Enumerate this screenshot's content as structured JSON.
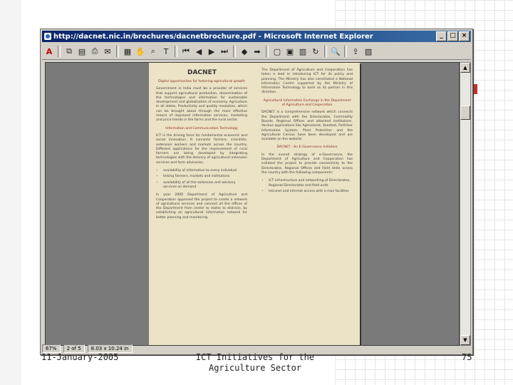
{
  "window": {
    "title": "http://dacnet.nic.in/brochures/dacnetbrochure.pdf - Microsoft Internet Explorer",
    "buttons": [
      "_",
      "□",
      "×"
    ]
  },
  "toolbar": {
    "icons": [
      "acrobat-icon",
      "separator",
      "copy-icon",
      "save-icon",
      "print-icon",
      "mail-icon",
      "separator",
      "pages-icon",
      "hand-tool-icon",
      "zoom-tool-icon",
      "text-select-icon",
      "separator",
      "first-page-icon",
      "prev-page-icon",
      "next-page-icon",
      "last-page-icon",
      "separator",
      "back-icon",
      "forward-icon",
      "separator",
      "actual-size-icon",
      "fit-page-icon",
      "fit-width-icon",
      "rotate-icon",
      "separator",
      "find-icon",
      "separator",
      "export-icon",
      "settings-icon"
    ]
  },
  "statusbar": {
    "zoom": "67%",
    "page": "2 of 5",
    "size": "8.03 x 10.24 in"
  },
  "pdf": {
    "title": "DACNET",
    "left_col": {
      "subtitle": "Digital opportunities for fostering agricultural growth",
      "p1": "Government in India must be a provider of services that support agricultural production, dissemination of the technologies and information for sustainable development and globalisation of economy. Agriculture in all states, Productivity and quality revolution, which can be brought about through the most effective means of improved information services, marketing and price trends in the farms and the rural sector.",
      "heading": "Information and Communication Technology",
      "p2": "ICT is the driving force for fundamental economic and social innovation. It connects farmers, scientists, extension workers and markets across the country. Different applications for the improvement of rural farmers are being developed by integrating technologies with the delivery of agricultural extension services and farm advisories.",
      "bullets": [
        "availability of information to every individual",
        "linking farmers, markets and institutions",
        "availability of all the extension and advisory services on demand"
      ],
      "p3": "In year 2000 Department of Agriculture and Cooperation approved the project to create a network of agricultural services and connect all the offices of the Department from center to states to districts, by establishing an agricultural information network for better planning and monitoring."
    },
    "right_col": {
      "p1": "The Department of Agriculture and Cooperation has taken a lead in introducing ICT for its policy and planning. The Ministry has also constituted a National Informatics Centre supported by the Ministry of Information Technology to work as its partner in this direction.",
      "heading": "Agricultural Information Exchange in the Department of Agriculture and Cooperation",
      "p2": "DACNET is a comprehensive network which connects the Department with the Directorates, Commodity Boards, Regional Offices and attached Institutions. Various applications like Agmarknet, Seednet, Fertiliser Information System, Plant Protection and the Agricultural Census have been developed and are available on the website.",
      "heading2": "DACNET - An E-Governance Initiative",
      "p3": "In the overall strategy of e-Governance, the Department of Agriculture and Cooperation has initiated the project to provide connectivity to the Directorates, Regional Offices and Field Units across the country with the following components:",
      "bullets": [
        "ICT infrastructure and networking of Directorates, Regional Directorates and field units",
        "Intranet and Internet access with e-mail facilities"
      ]
    }
  },
  "footer": {
    "date": "11-January-2005",
    "title": "ICT Initiatives for the Agriculture Sector",
    "page_number": "75"
  }
}
